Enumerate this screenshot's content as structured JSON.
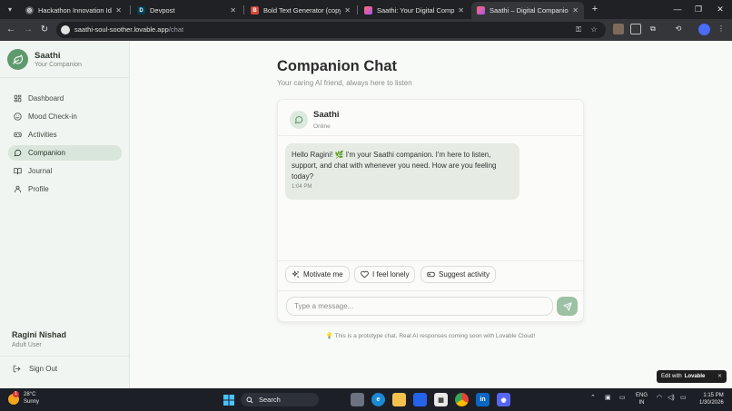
{
  "browser": {
    "tabs": [
      {
        "label": "Hackathon Innovation Ideas",
        "icon": "chatgpt-favicon-icon",
        "active": false
      },
      {
        "label": "Devpost",
        "icon": "devpost-favicon-icon",
        "active": false
      },
      {
        "label": "Bold Text Generator (copy & p",
        "icon": "bold-text-favicon-icon",
        "active": false
      },
      {
        "label": "Saathi: Your Digital Companion",
        "icon": "lovable-favicon-icon",
        "active": false
      },
      {
        "label": "Saathi – Digital Companion for",
        "icon": "lovable-favicon-icon",
        "active": true
      }
    ],
    "url_host": "saathi-soul-soother.lovable.app",
    "url_path": "/chat"
  },
  "sidebar": {
    "brand_name": "Saathi",
    "brand_sub": "Your Companion",
    "items": [
      {
        "label": "Dashboard",
        "icon": "dashboard-icon",
        "active": false
      },
      {
        "label": "Mood Check-in",
        "icon": "smile-icon",
        "active": false
      },
      {
        "label": "Activities",
        "icon": "gamepad-icon",
        "active": false
      },
      {
        "label": "Companion",
        "icon": "chat-icon",
        "active": true
      },
      {
        "label": "Journal",
        "icon": "book-icon",
        "active": false
      },
      {
        "label": "Profile",
        "icon": "user-icon",
        "active": false
      }
    ],
    "user_name": "Ragini Nishad",
    "user_role": "Adult User",
    "signout_label": "Sign Out"
  },
  "main": {
    "title": "Companion Chat",
    "subtitle": "Your caring AI friend, always here to listen",
    "chat": {
      "bot_name": "Saathi",
      "bot_status": "Online",
      "messages": [
        {
          "text": "Hello Ragini! 🌿 I'm your Saathi companion. I'm here to listen, support, and chat with whenever you need. How are you feeling today?",
          "time": "1:04 PM"
        }
      ],
      "quick_replies": [
        {
          "label": "Motivate me",
          "icon": "sparkles-icon"
        },
        {
          "label": "I feel lonely",
          "icon": "heart-icon"
        },
        {
          "label": "Suggest activity",
          "icon": "gamepad-icon"
        }
      ],
      "input_placeholder": "Type a message...",
      "send_icon": "send-icon"
    },
    "footnote": "This is a prototype chat. Real AI responses coming soon with Lovable Cloud!",
    "badge_prefix": "Edit with",
    "badge_brand": "Lovable"
  },
  "taskbar": {
    "weather_temp": "28°C",
    "weather_desc": "Sunny",
    "weather_badge": "1",
    "search_label": "Search",
    "lang_1": "ENG",
    "lang_2": "IN",
    "time": "1:15 PM",
    "date": "1/30/2026"
  },
  "colors": {
    "accent": "#5e9a6d",
    "active_nav": "#d9e6db",
    "bubble": "#e6ebe4",
    "send": "#9cc1a4"
  }
}
